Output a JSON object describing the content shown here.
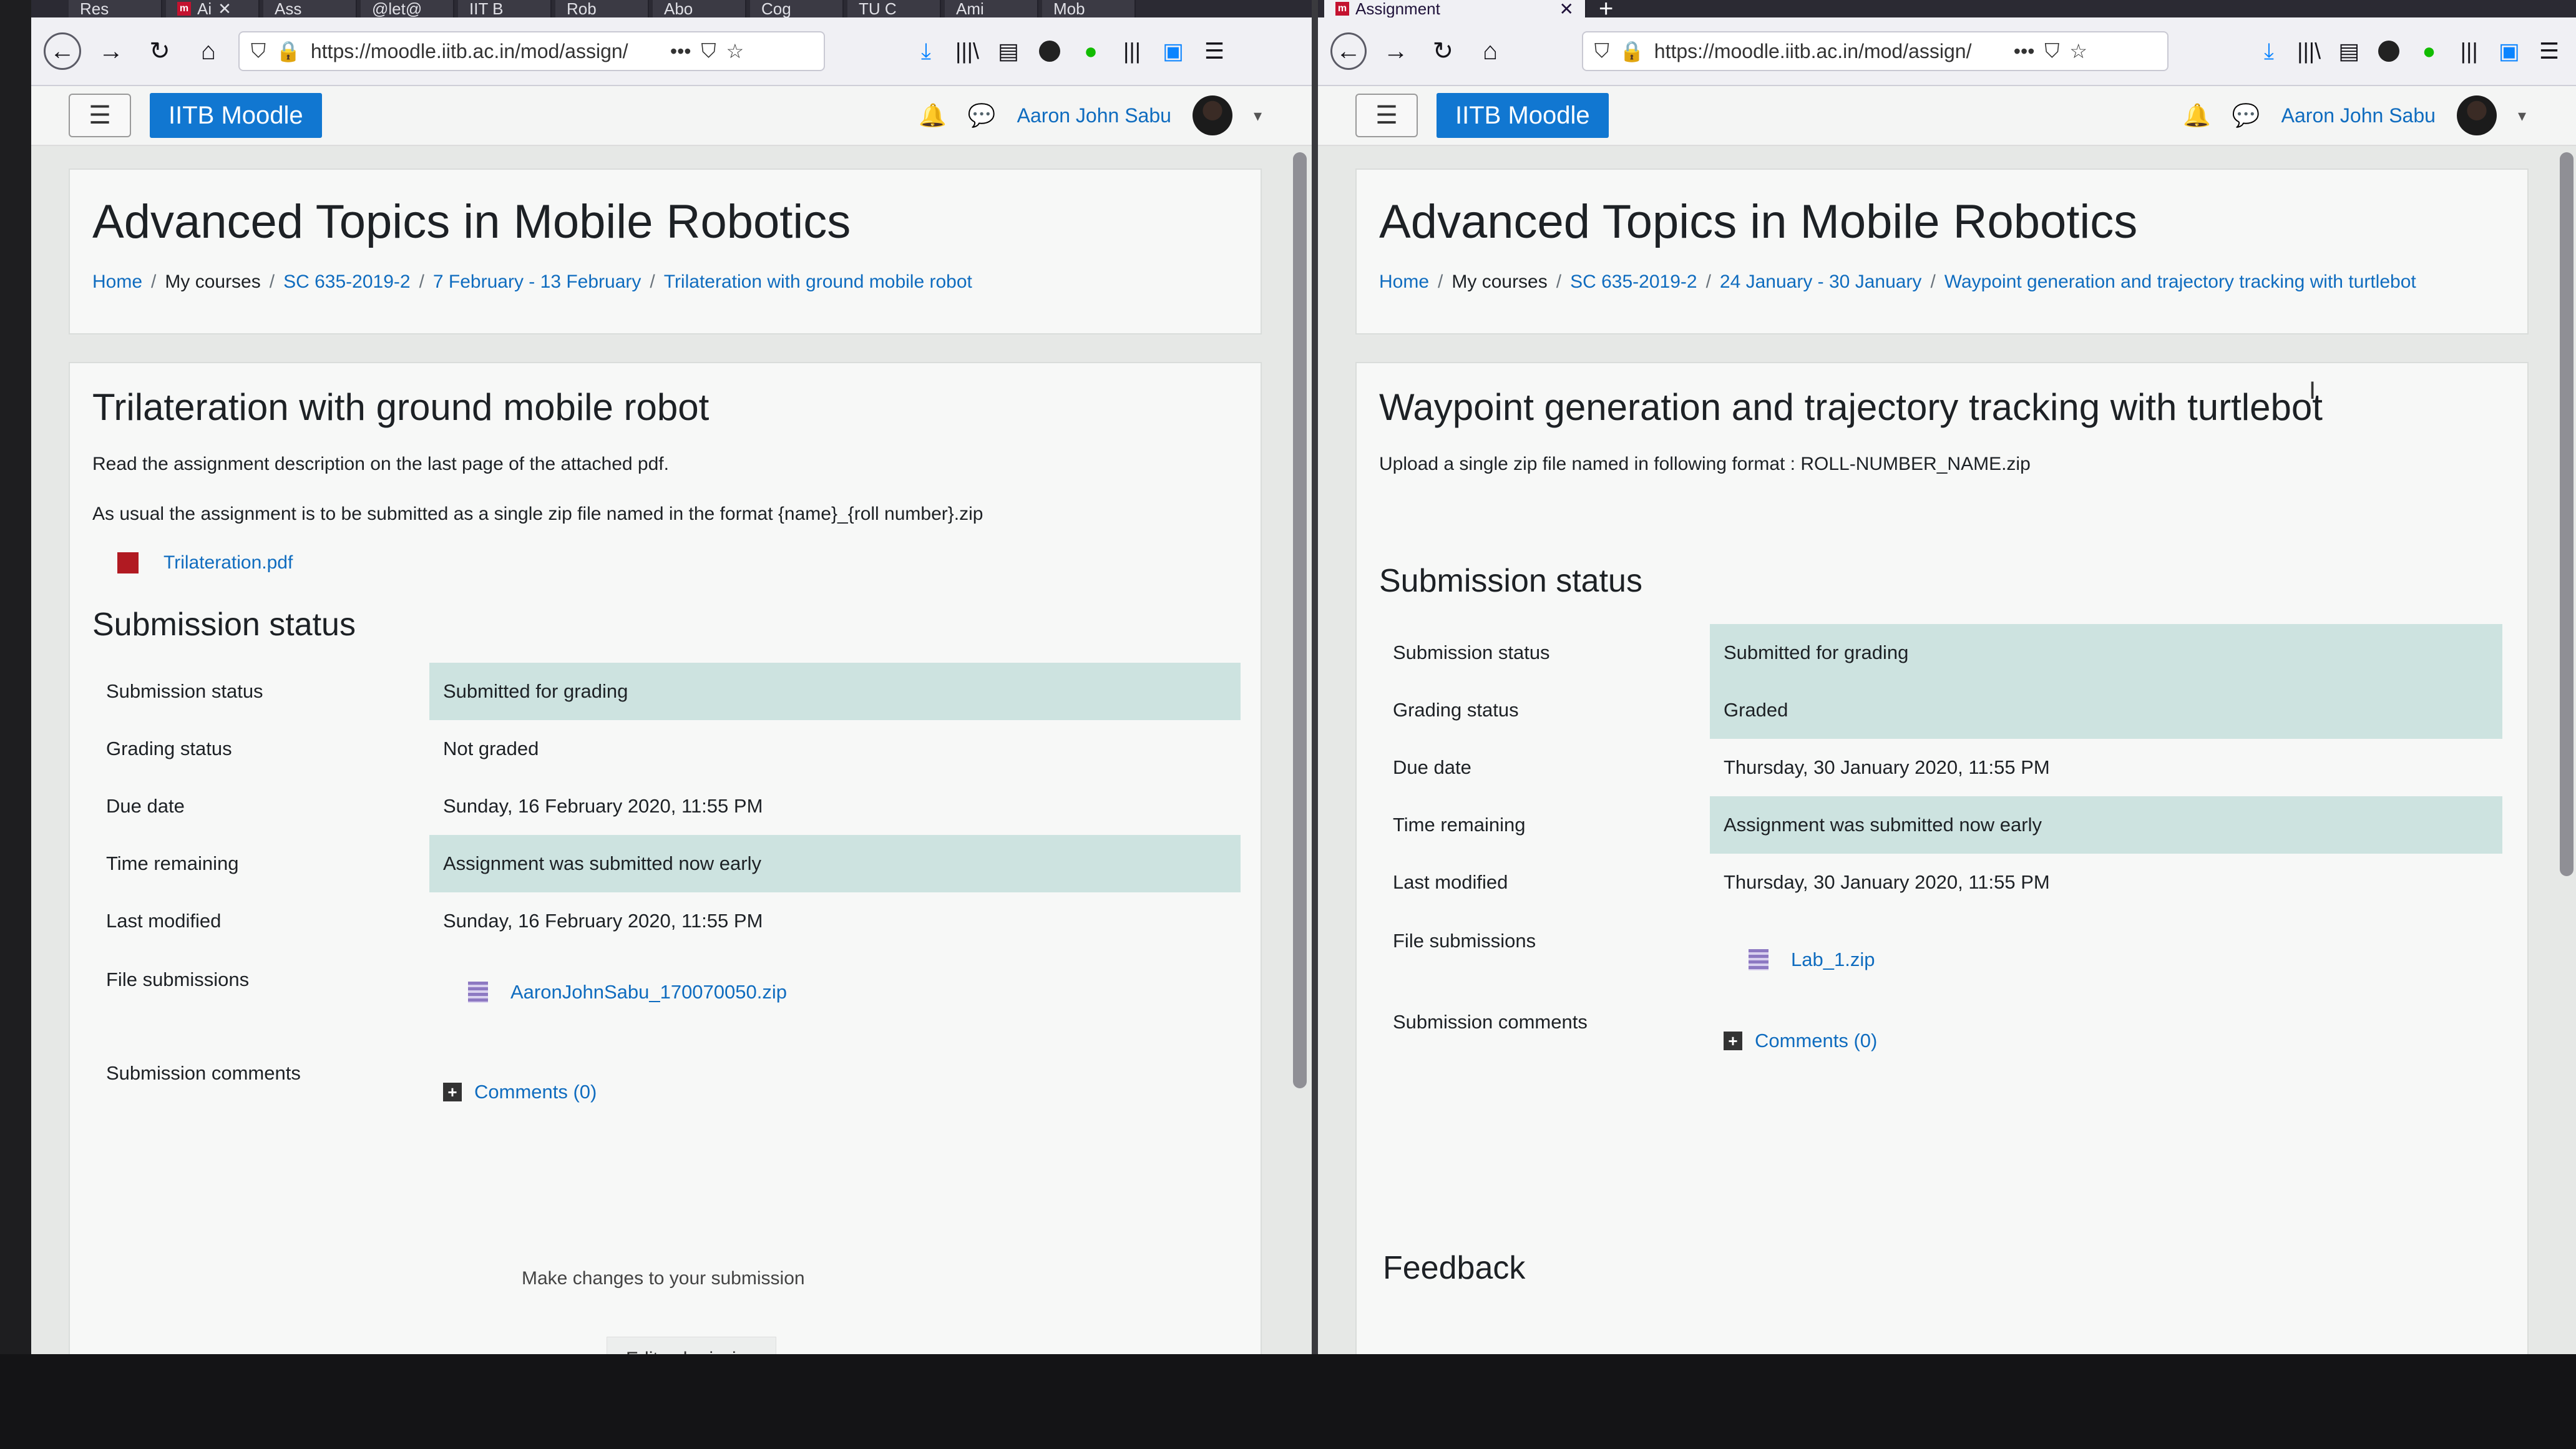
{
  "left": {
    "tabs": [
      "Res",
      "Ai",
      "Ass",
      "@let@",
      "IIT B",
      "Rob",
      "Abo",
      "Cog",
      "TU C",
      "Ami",
      "Mob"
    ],
    "url": "https://moodle.iitb.ac.in/mod/assign/",
    "brand": "IITB Moodle",
    "username": "Aaron John Sabu",
    "course_title": "Advanced Topics in Mobile Robotics",
    "breadcrumb": [
      "Home",
      "My courses",
      "SC 635-2019-2",
      "7 February - 13 February",
      "Trilateration with ground mobile robot"
    ],
    "activity_title": "Trilateration with ground mobile robot",
    "description_1": "Read the assignment description on the last page of the attached pdf.",
    "description_2": "As usual the assignment is to be submitted as a single zip file named in the format {name}_{roll number}.zip",
    "attachment": "Trilateration.pdf",
    "section_title": "Submission status",
    "rows": {
      "submission_status": {
        "label": "Submission status",
        "value": "Submitted for grading"
      },
      "grading_status": {
        "label": "Grading status",
        "value": "Not graded"
      },
      "due_date": {
        "label": "Due date",
        "value": "Sunday, 16 February 2020, 11:55 PM"
      },
      "time_remaining": {
        "label": "Time remaining",
        "value": "Assignment was submitted now early"
      },
      "last_modified": {
        "label": "Last modified",
        "value": "Sunday, 16 February 2020, 11:55 PM"
      },
      "file_submissions": {
        "label": "File submissions",
        "value": "AaronJohnSabu_170070050.zip"
      },
      "submission_comments": {
        "label": "Submission comments",
        "value": "Comments (0)"
      }
    },
    "edit_button": "Edit submission",
    "edit_help": "Make changes to your submission"
  },
  "right": {
    "tab_active": "Assignment",
    "url": "https://moodle.iitb.ac.in/mod/assign/",
    "brand": "IITB Moodle",
    "username": "Aaron John Sabu",
    "course_title": "Advanced Topics in Mobile Robotics",
    "breadcrumb": [
      "Home",
      "My courses",
      "SC 635-2019-2",
      "24 January - 30 January",
      "Waypoint generation and trajectory tracking with turtlebot"
    ],
    "activity_title": "Waypoint generation and trajectory tracking with turtlebot",
    "description_1": "Upload a single zip file named in following format : ROLL-NUMBER_NAME.zip",
    "section_title": "Submission status",
    "rows": {
      "submission_status": {
        "label": "Submission status",
        "value": "Submitted for grading"
      },
      "grading_status": {
        "label": "Grading status",
        "value": "Graded"
      },
      "due_date": {
        "label": "Due date",
        "value": "Thursday, 30 January 2020, 11:55 PM"
      },
      "time_remaining": {
        "label": "Time remaining",
        "value": "Assignment was submitted now early"
      },
      "last_modified": {
        "label": "Last modified",
        "value": "Thursday, 30 January 2020, 11:55 PM"
      },
      "file_submissions": {
        "label": "File submissions",
        "value": "Lab_1.zip"
      },
      "submission_comments": {
        "label": "Submission comments",
        "value": "Comments (0)"
      }
    },
    "feedback_title": "Feedback"
  },
  "colors": {
    "brand": "#1177d1",
    "link": "#0f6cbf",
    "highlight": "#cde3e0"
  }
}
